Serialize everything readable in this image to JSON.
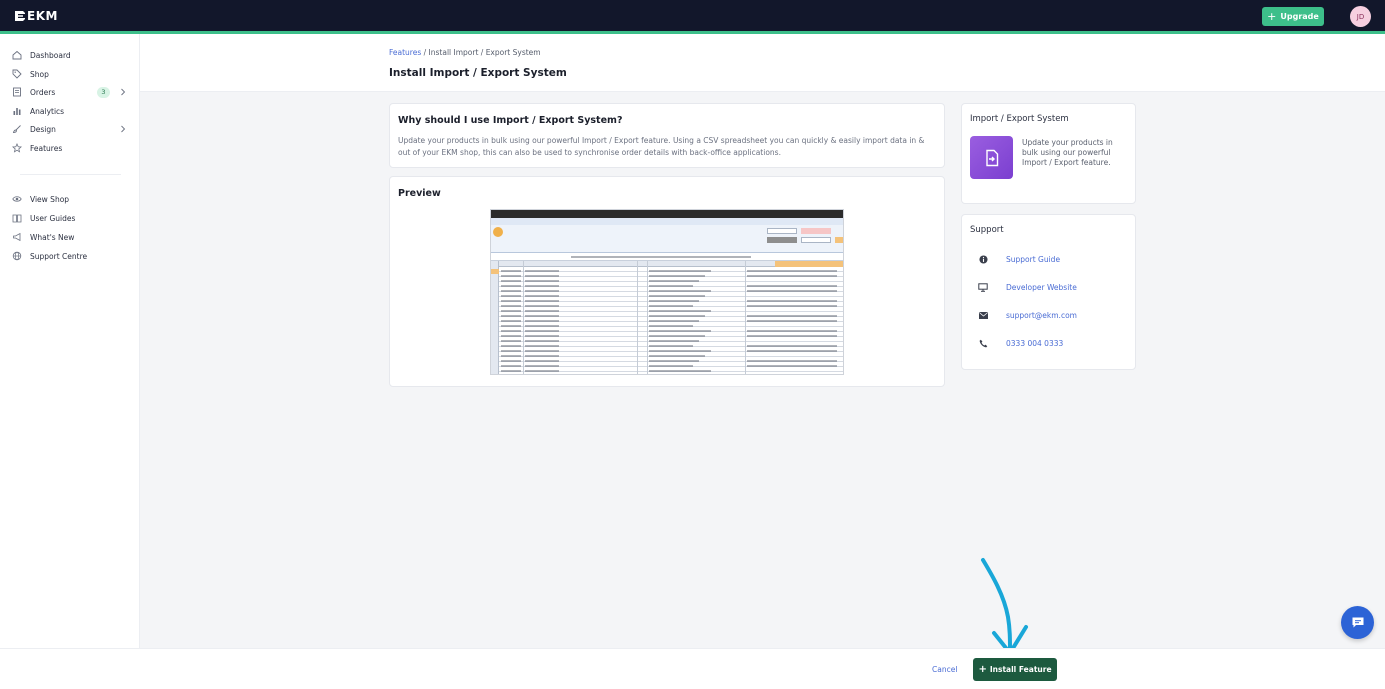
{
  "app": {
    "logo_text": "EKM"
  },
  "topbar": {
    "upgrade_label": "Upgrade",
    "avatar_initials": "JD"
  },
  "sidebar": {
    "items": [
      {
        "label": "Dashboard",
        "icon": "home-icon"
      },
      {
        "label": "Shop",
        "icon": "tag-icon"
      },
      {
        "label": "Orders",
        "icon": "orders-icon",
        "badge": "3",
        "has_chevron": true
      },
      {
        "label": "Analytics",
        "icon": "analytics-icon"
      },
      {
        "label": "Design",
        "icon": "brush-icon",
        "has_chevron": true
      },
      {
        "label": "Features",
        "icon": "star-icon"
      }
    ],
    "secondary_items": [
      {
        "label": "View Shop",
        "icon": "eye-icon"
      },
      {
        "label": "User Guides",
        "icon": "book-icon"
      },
      {
        "label": "What's New",
        "icon": "megaphone-icon"
      },
      {
        "label": "Support Centre",
        "icon": "globe-icon"
      }
    ]
  },
  "header": {
    "breadcrumb_link": "Features",
    "breadcrumb_sep": " / ",
    "breadcrumb_current": "Install Import / Export System",
    "title": "Install Import / Export System"
  },
  "why_card": {
    "title": "Why should I use Import / Export System?",
    "text": "Update your products in bulk using our powerful Import / Export feature. Using a CSV spreadsheet you can quickly & easily import data in & out of your EKM shop, this can also be used to synchronise order details with back-office applications."
  },
  "preview_card": {
    "title": "Preview"
  },
  "feature_card": {
    "title": "Import / Export System",
    "description": "Update your products in bulk using our powerful Import / Export feature."
  },
  "support_card": {
    "title": "Support",
    "items": [
      {
        "label": "Support Guide",
        "icon": "info-icon"
      },
      {
        "label": "Developer Website",
        "icon": "monitor-icon"
      },
      {
        "label": "support@ekm.com",
        "icon": "envelope-icon"
      },
      {
        "label": "0333 004 0333",
        "icon": "phone-icon"
      }
    ]
  },
  "footer": {
    "cancel_label": "Cancel",
    "install_label": "Install Feature"
  },
  "colors": {
    "brand_dark": "#12172b",
    "accent_green": "#3dbf8a",
    "install_green": "#1d5a3f",
    "link_blue": "#4a6cd4",
    "chat_blue": "#2c63d6"
  }
}
